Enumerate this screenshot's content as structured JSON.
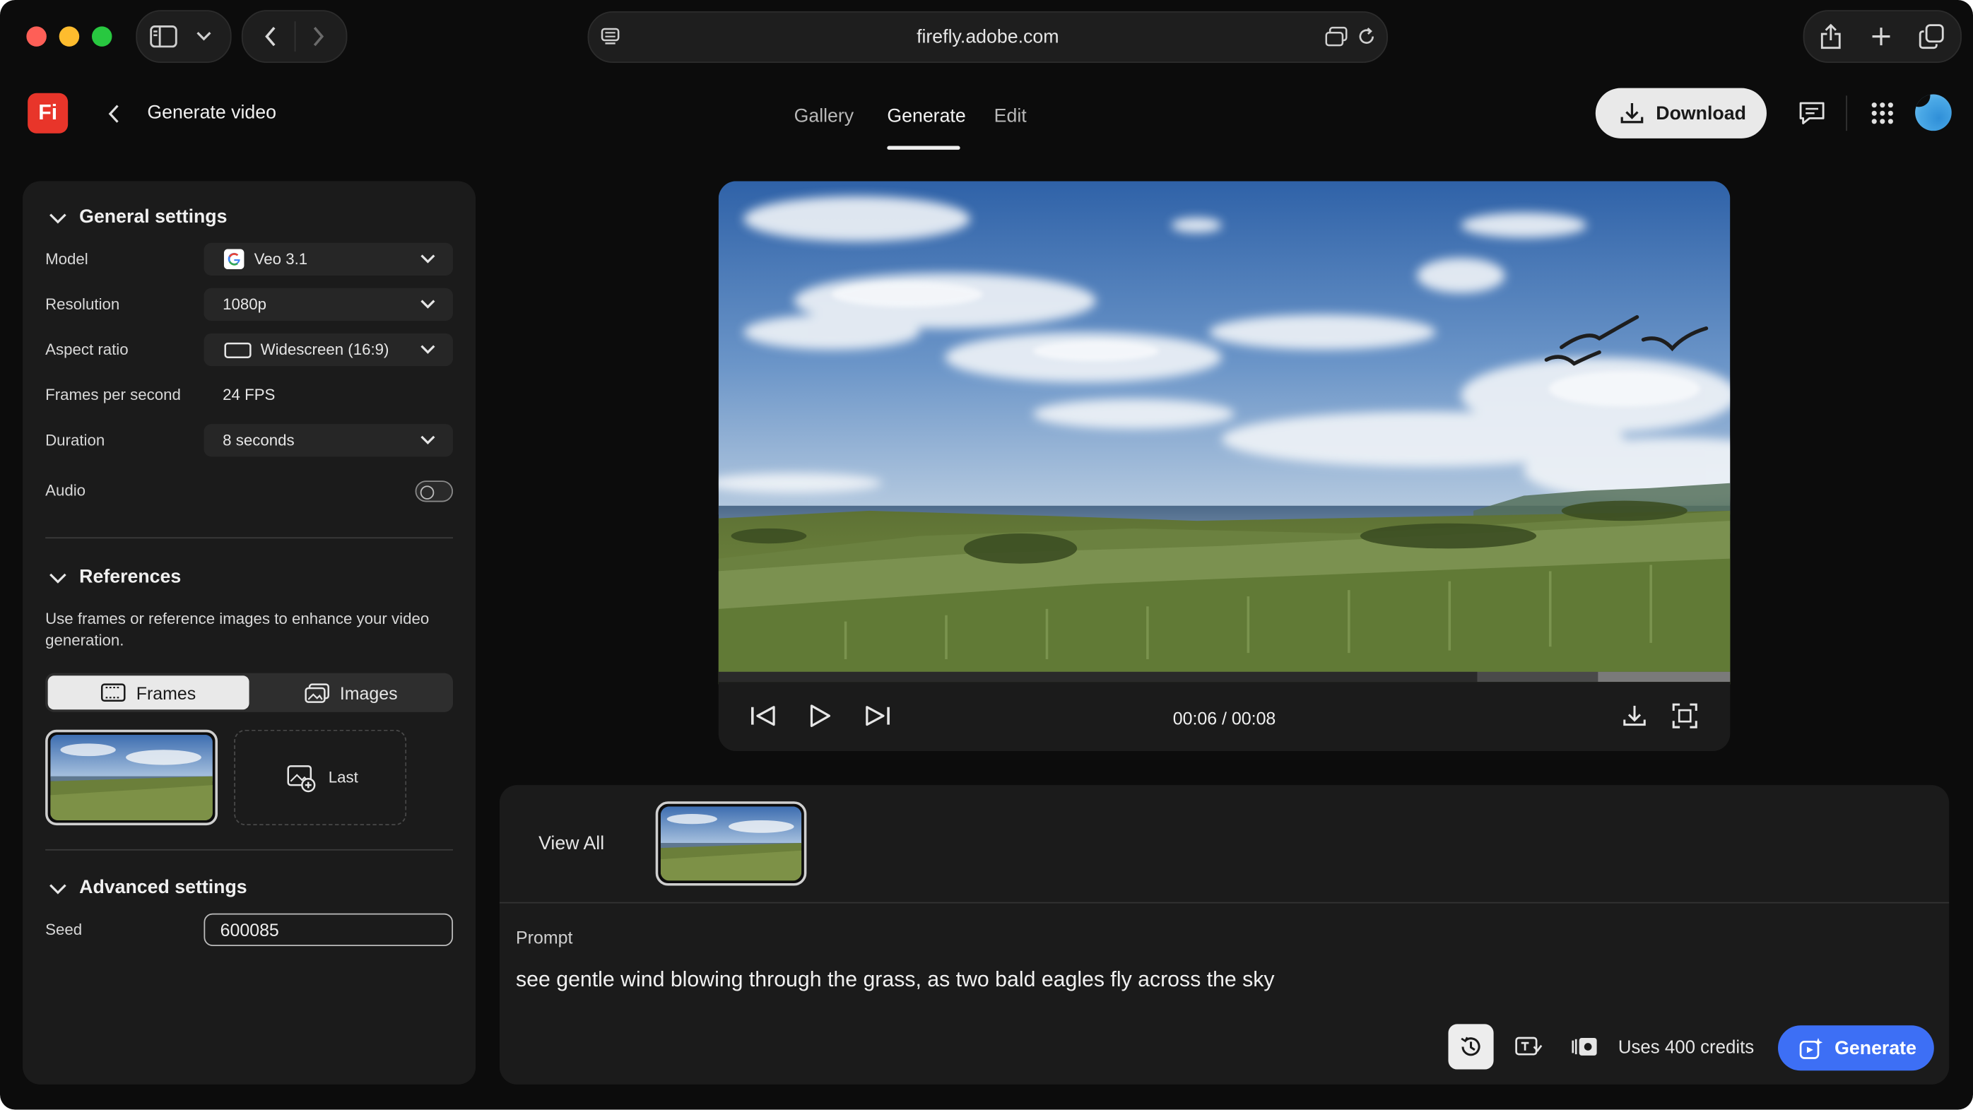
{
  "browser": {
    "url": "firefly.adobe.com"
  },
  "app": {
    "logo_text": "Fi",
    "page_title": "Generate video",
    "tabs": [
      {
        "label": "Gallery",
        "active": false
      },
      {
        "label": "Generate",
        "active": true
      },
      {
        "label": "Edit",
        "active": false
      }
    ],
    "download_label": "Download"
  },
  "general_settings": {
    "title": "General settings",
    "model_label": "Model",
    "model_value": "Veo 3.1",
    "resolution_label": "Resolution",
    "resolution_value": "1080p",
    "aspect_label": "Aspect ratio",
    "aspect_value": "Widescreen (16:9)",
    "fps_label": "Frames per second",
    "fps_value": "24 FPS",
    "duration_label": "Duration",
    "duration_value": "8 seconds",
    "audio_label": "Audio",
    "audio_on": false
  },
  "references": {
    "title": "References",
    "description": "Use frames or reference images to enhance your video generation.",
    "frames_label": "Frames",
    "images_label": "Images",
    "active_toggle": "Frames",
    "last_label": "Last"
  },
  "advanced_settings": {
    "title": "Advanced settings",
    "seed_label": "Seed",
    "seed_value": "600085"
  },
  "player": {
    "time": "00:06 / 00:08",
    "progress": 0.75
  },
  "history": {
    "view_all_label": "View All"
  },
  "prompt": {
    "label": "Prompt",
    "text": "see gentle wind blowing through the grass, as two bald eagles fly across the sky",
    "credits_label": "Uses 400 credits",
    "generate_label": "Generate"
  },
  "colors": {
    "accent": "#3d6ff5",
    "logo_bg": "#e8352a",
    "avatar": "#4aa8e6"
  }
}
